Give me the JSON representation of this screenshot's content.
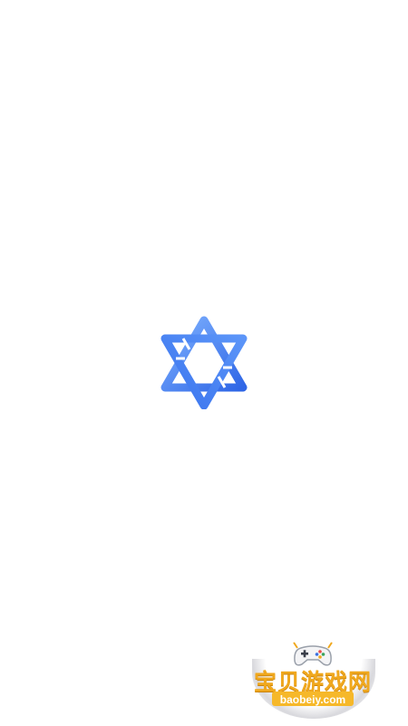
{
  "splash": {
    "logo_icon": "hexagram-interlaced-star-icon",
    "logo_colors": [
      "#6aa3ff",
      "#3f7bf0",
      "#2f66e6"
    ],
    "background_color": "#ffffff"
  },
  "watermark": {
    "icon": "game-controller-icon",
    "title": "宝贝游戏网",
    "url": "baobeiy.com",
    "title_color": "#f0a81e",
    "pill_color": "#f6b82a"
  }
}
